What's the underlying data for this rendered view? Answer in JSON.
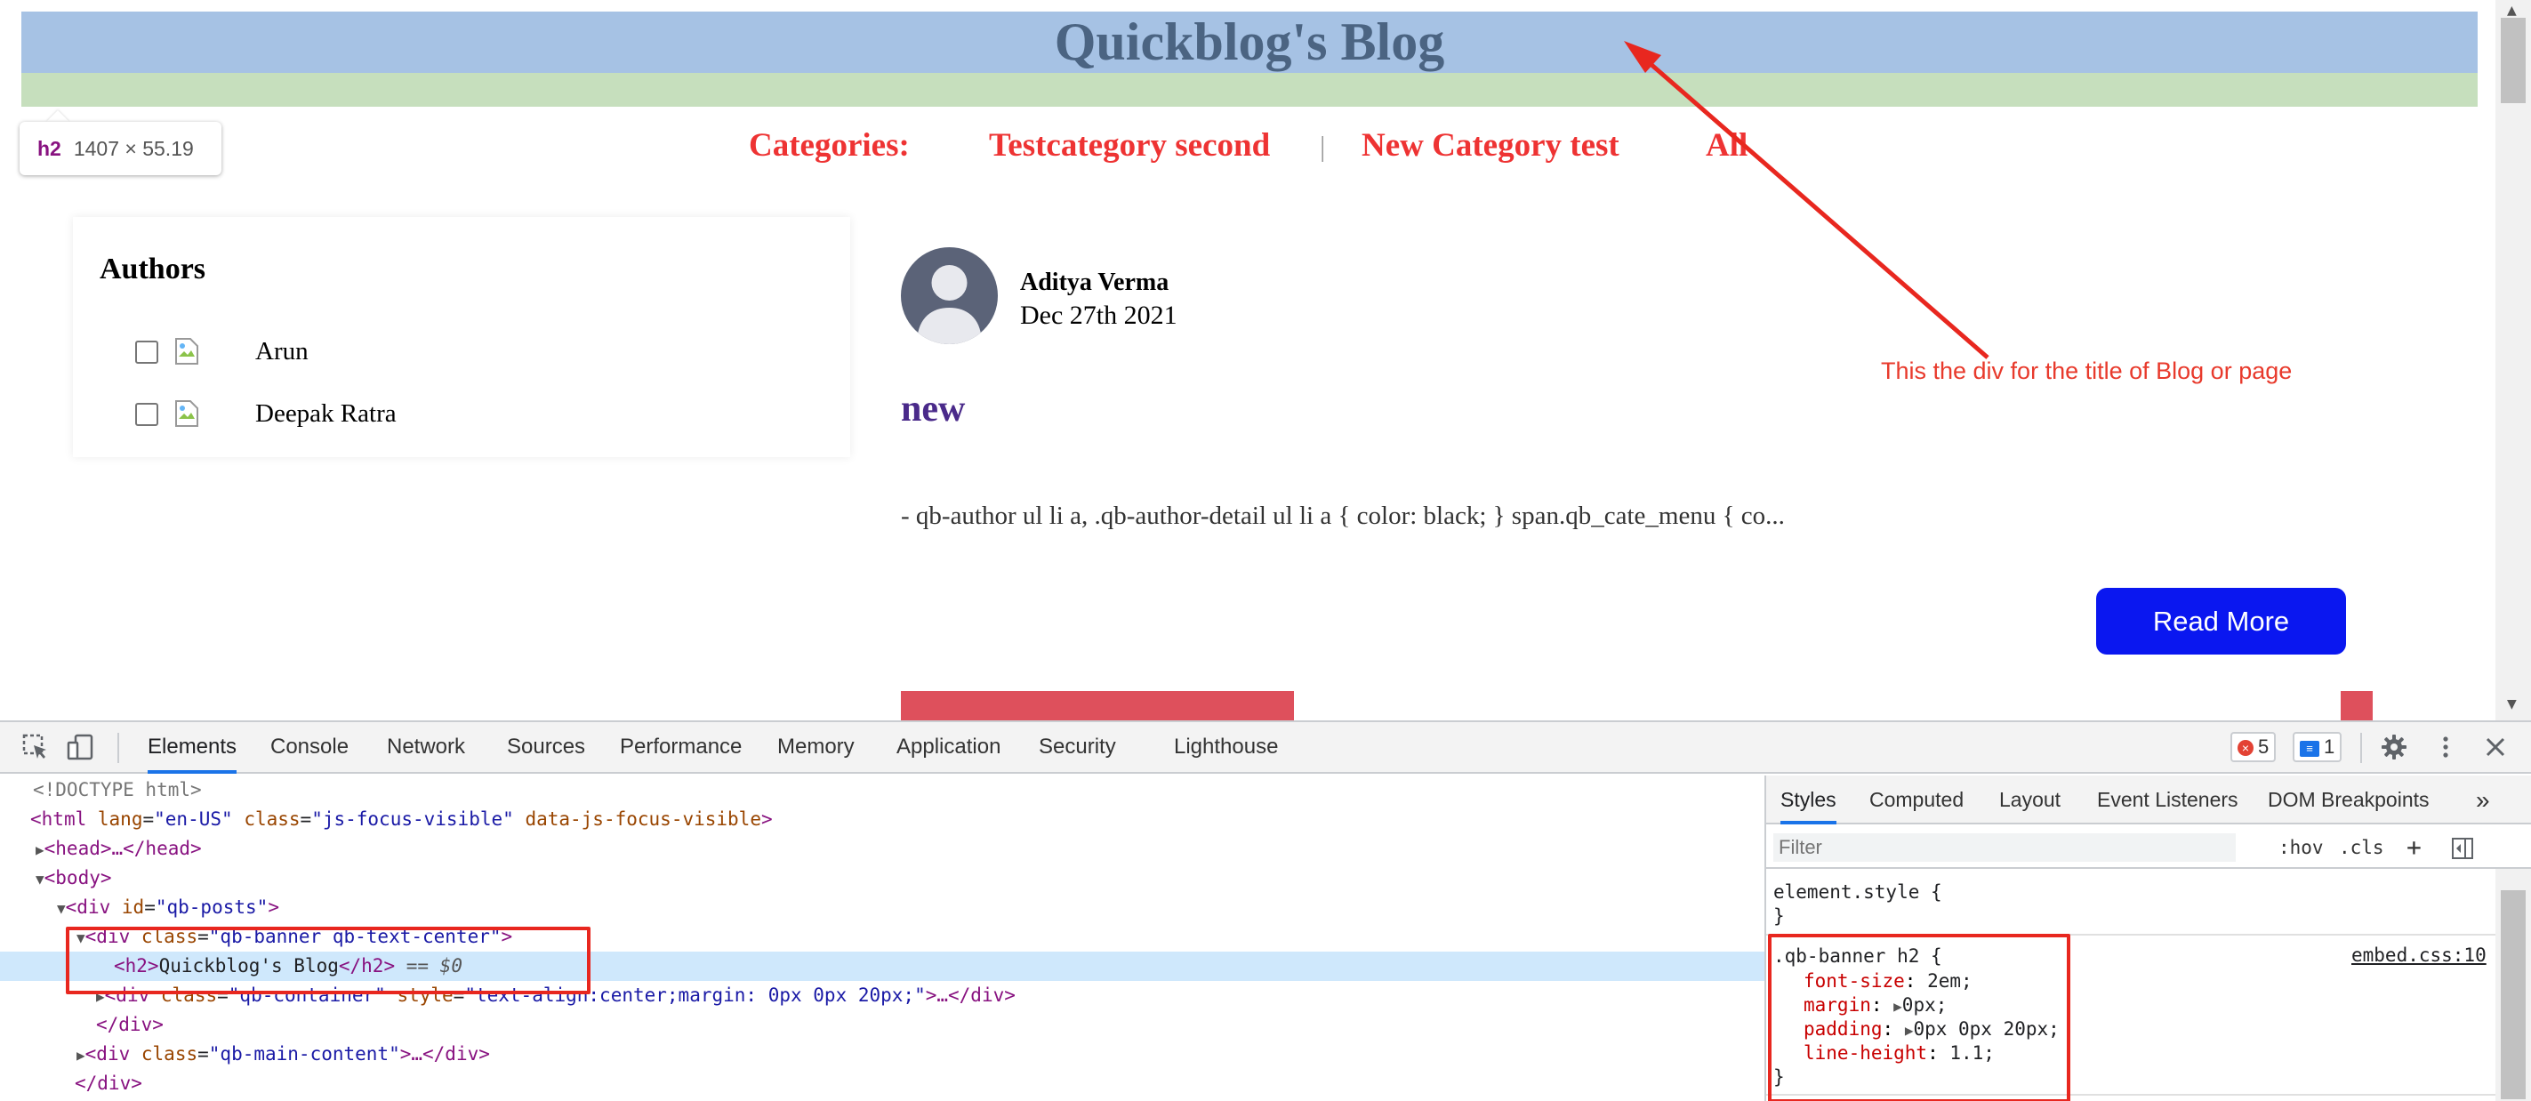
{
  "page": {
    "banner_title": "Quickblog's Blog",
    "tooltip_tag": "h2",
    "tooltip_dims": "1407 × 55.19",
    "categories": {
      "label": "Categories:",
      "items": [
        "Testcategory second",
        "New Category test",
        "All"
      ],
      "separator": "|"
    },
    "authors": {
      "title": "Authors",
      "list": [
        {
          "name": "Arun"
        },
        {
          "name": "Deepak Ratra"
        }
      ]
    },
    "post": {
      "author": "Aditya Verma",
      "date": "Dec 27th 2021",
      "title": "new",
      "excerpt": "- qb-author ul li a, .qb-author-detail ul li a { color: black; } span.qb_cate_menu { co...",
      "read_more": "Read More"
    },
    "annotation": "This the div for the title of Blog or page",
    "colors": {
      "banner_blue": "#a6c2e4",
      "banner_green": "#c6dfbd",
      "category_red": "#ee3333",
      "button_blue": "#0a17f0",
      "annotation_red": "#e83a2c"
    }
  },
  "devtools": {
    "tabs": [
      "Elements",
      "Console",
      "Network",
      "Sources",
      "Performance",
      "Memory",
      "Application",
      "Security",
      "Lighthouse"
    ],
    "active_tab": "Elements",
    "error_count": "5",
    "message_count": "1",
    "icons": [
      "inspect-icon",
      "device-toggle-icon",
      "error-icon",
      "message-icon",
      "settings-gear-icon",
      "more-vertical-icon",
      "close-icon"
    ],
    "dom": {
      "doctype": "<!DOCTYPE html>",
      "html_open": {
        "tag": "html",
        "attrs": [
          [
            "lang",
            "en-US"
          ],
          [
            "class",
            "js-focus-visible"
          ],
          [
            "data-js-focus-visible",
            null
          ]
        ]
      },
      "head": "<head>…</head>",
      "body_open": "<body>",
      "qb_posts": {
        "tag": "div",
        "attr": "id",
        "value": "qb-posts"
      },
      "qb_banner": {
        "tag": "div",
        "attr": "class",
        "value": "qb-banner qb-text-center"
      },
      "h2_text": "Quickblog's Blog",
      "selected_marker": "== $0",
      "qb_container": {
        "tag": "div",
        "class": "qb-container",
        "style": "text-align:center;margin: 0px 0px 20px;"
      },
      "div_close": "</div>",
      "qb_main": {
        "tag": "div",
        "attr": "class",
        "value": "qb-main-content"
      },
      "div_close2": "</div>"
    },
    "styles_tabs": [
      "Styles",
      "Computed",
      "Layout",
      "Event Listeners",
      "DOM Breakpoints"
    ],
    "styles_more": "»",
    "filter_placeholder": "Filter",
    "filter_hov": ":hov",
    "filter_cls": ".cls",
    "filter_plus": "+",
    "element_style_open": "element.style {",
    "element_style_close": "}",
    "rule": {
      "selector": ".qb-banner h2 {",
      "source": "embed.css:10",
      "props": [
        {
          "name": "font-size",
          "value": "2em;",
          "expand": false
        },
        {
          "name": "margin",
          "value": "0px;",
          "expand": true
        },
        {
          "name": "padding",
          "value": "0px 0px 20px;",
          "expand": true
        },
        {
          "name": "line-height",
          "value": "1.1;",
          "expand": false
        }
      ],
      "close": "}"
    }
  }
}
